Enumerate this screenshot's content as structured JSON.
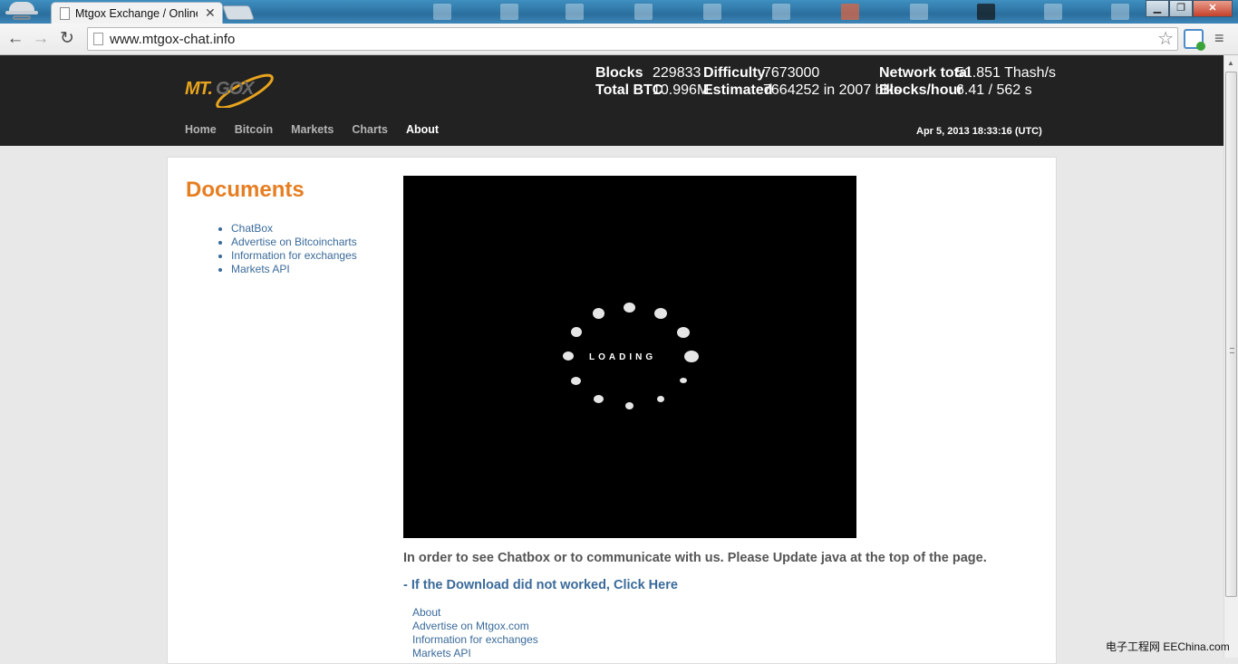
{
  "browser": {
    "tab_title": "Mtgox Exchange / Online",
    "tab_close": "✕",
    "url": "www.mtgox-chat.info",
    "window_controls": {
      "minimize": "▁",
      "maximize": "❐",
      "close": "✕"
    },
    "icons": {
      "back": "arrow-left",
      "forward": "arrow-right",
      "reload": "reload",
      "star": "star",
      "menu": "wrench"
    }
  },
  "site": {
    "logo": {
      "mt": "MT.",
      "gox": "GOX"
    },
    "stats": {
      "blocks_label": "Blocks",
      "blocks_value": "229833",
      "difficulty_label": "Difficulty",
      "difficulty_value": "7673000",
      "network_label": "Network total",
      "network_value": "51.851 Thash/s",
      "total_btc_label": "Total BTC",
      "total_btc_value": "10.996M",
      "estimated_label": "Estimated",
      "estimated_value": "7664252 in 2007 blks",
      "blocks_hour_label": "Blocks/hour",
      "blocks_hour_value": "6.41 / 562 s"
    },
    "nav": [
      "Home",
      "Bitcoin",
      "Markets",
      "Charts",
      "About"
    ],
    "active_nav": "About",
    "timestamp": "Apr 5, 2013 18:33:16 (UTC)",
    "colors": {
      "header_bg": "#222222",
      "accent_orange": "#e67e22",
      "link_blue": "#3a6a9a"
    }
  },
  "sidebar": {
    "title": "Documents",
    "items": [
      "ChatBox",
      "Advertise on Bitcoincharts",
      "Information for exchanges",
      "Markets API"
    ]
  },
  "main": {
    "loading_text": "LOADING",
    "java_message": "In order to see Chatbox or to communicate with us. Please Update java at the top of the page.",
    "download_link": "- If the Download did not worked, Click Here",
    "footer_links": [
      "About",
      "Advertise on Mtgox.com",
      "Information for exchanges",
      "Markets API"
    ]
  },
  "watermark": "电子工程网  EEChina.com"
}
